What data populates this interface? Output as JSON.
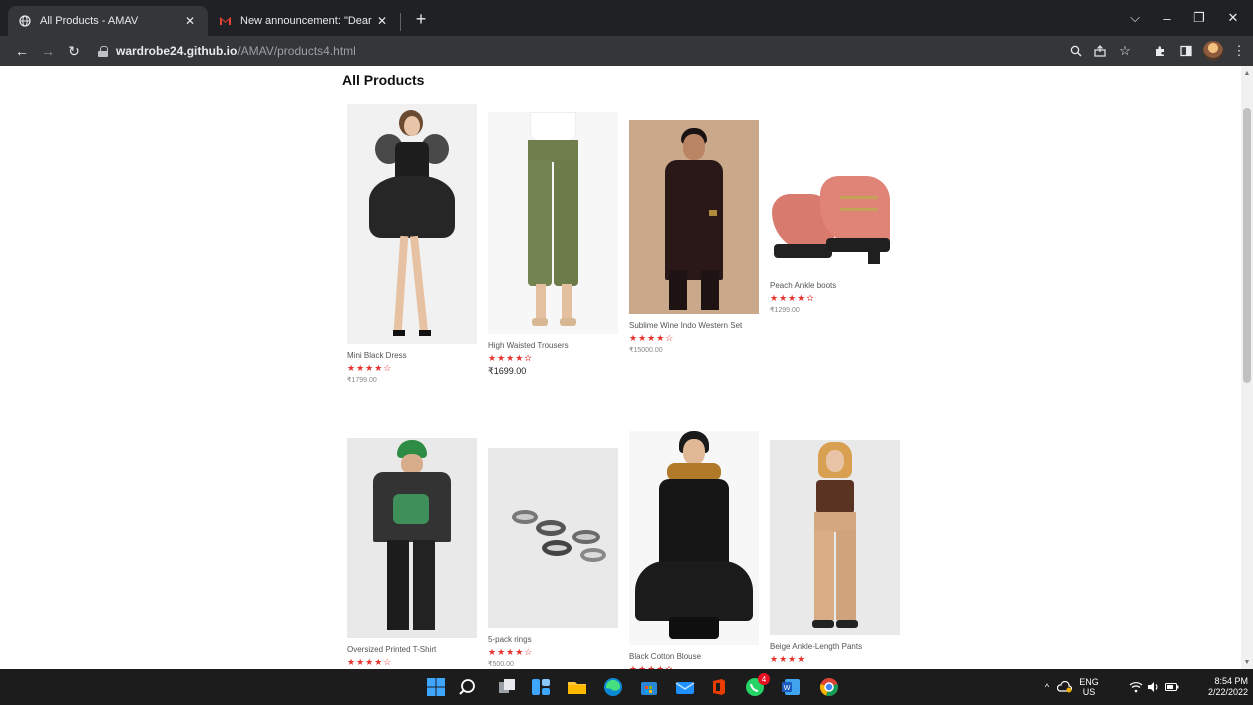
{
  "browser": {
    "tabs": [
      {
        "title": "All Products - AMAV",
        "active": true
      },
      {
        "title": "New announcement: \"Dear stude",
        "active": false
      }
    ],
    "url_host": "wardrobe24.github.io",
    "url_path": "/AMAV/products4.html"
  },
  "page": {
    "heading": "All Products",
    "products": [
      {
        "name": "Mini Black Dress",
        "rating": "★★★★☆",
        "price": "₹1799.00"
      },
      {
        "name": "High Waisted Trousers",
        "rating": "★★★★✫",
        "price": "₹1699.00"
      },
      {
        "name": "Sublime Wine Indo Western Set",
        "rating": "★★★★☆",
        "price": "₹15000.00"
      },
      {
        "name": "Peach Ankle boots",
        "rating": "★★★★✫",
        "price": "₹1299.00"
      },
      {
        "name": "Oversized Printed T-Shirt",
        "rating": "★★★★☆",
        "price": ""
      },
      {
        "name": "5-pack rings",
        "rating": "★★★★☆",
        "price": "₹500.00"
      },
      {
        "name": "Black Cotton Blouse",
        "rating": "★★★★✫",
        "price": ""
      },
      {
        "name": "Beige Ankle-Length Pants",
        "rating": "★★★★",
        "price": ""
      }
    ]
  },
  "taskbar": {
    "language": "ENG",
    "region": "US",
    "time": "8:54 PM",
    "date": "2/22/2022",
    "whatsapp_badge": "4"
  },
  "colors": {
    "star": "#e5322d",
    "tab_bar": "#202124",
    "toolbar": "#35363a",
    "taskbar": "#1c1c1c"
  }
}
